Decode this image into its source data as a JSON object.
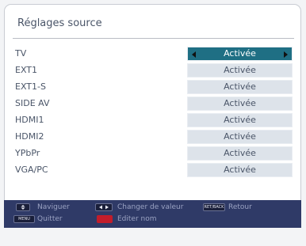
{
  "window": {
    "title": "Réglages source"
  },
  "rows": [
    {
      "label": "TV",
      "value": "Activée",
      "selected": true
    },
    {
      "label": "EXT1",
      "value": "Activée"
    },
    {
      "label": "EXT1-S",
      "value": "Activée"
    },
    {
      "label": "SIDE AV",
      "value": "Activée"
    },
    {
      "label": "HDMI1",
      "value": "Activée"
    },
    {
      "label": "HDMI2",
      "value": "Activée"
    },
    {
      "label": "YPbPr",
      "value": "Activée"
    },
    {
      "label": "VGA/PC",
      "value": "Activée"
    }
  ],
  "footer": {
    "navigate": "Naviguer",
    "change_value": "Changer de valeur",
    "return": "Retour",
    "return_key": "RET/BACK",
    "quit": "Quitter",
    "menu_key": "MENU",
    "edit_name": "Editer nom"
  },
  "colors": {
    "selected_bg": "#1f6f84",
    "footer_bg": "#2f3a67",
    "edit_key": "#c21d2b"
  }
}
